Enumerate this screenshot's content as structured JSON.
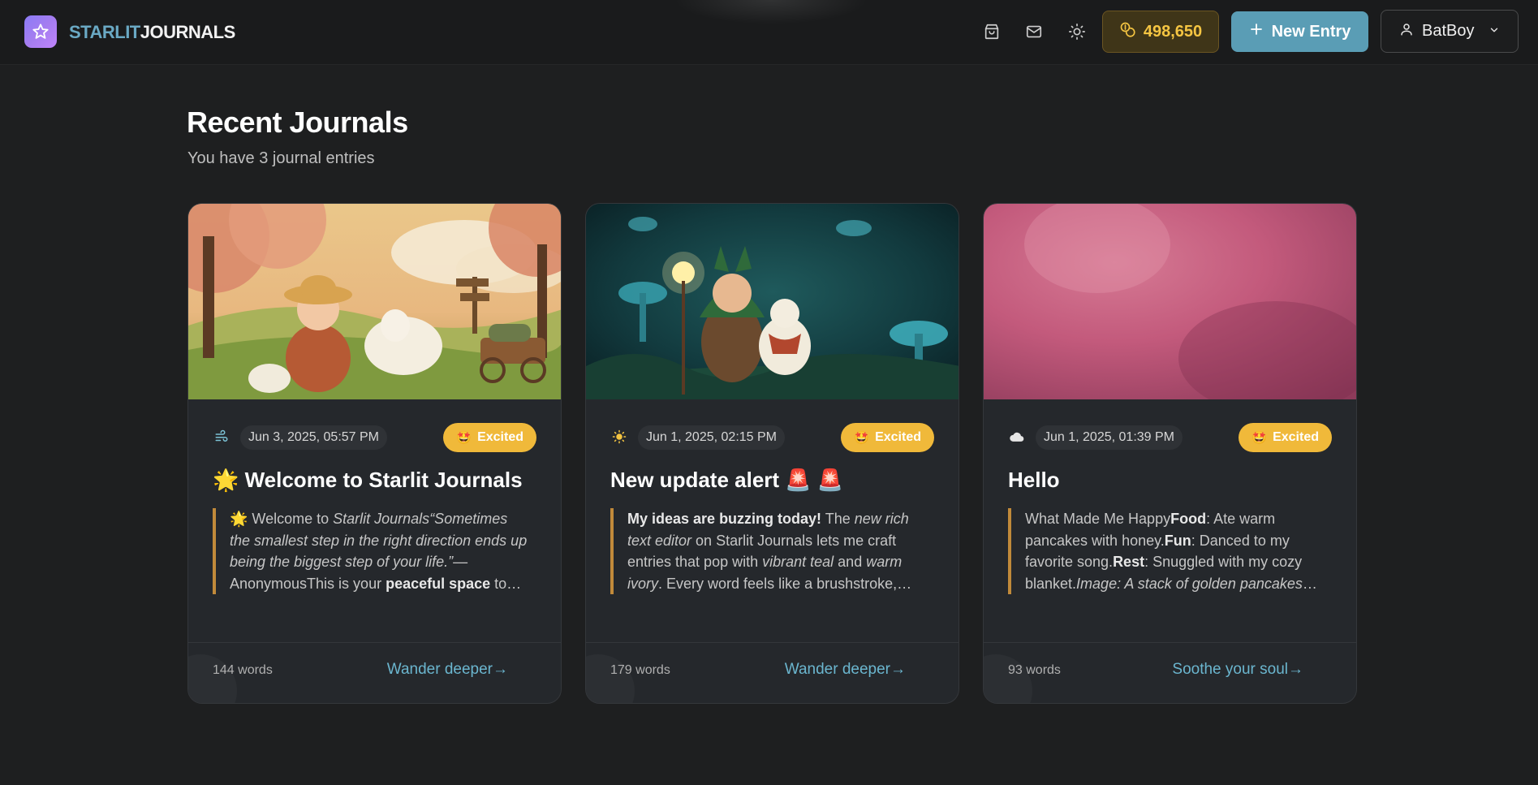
{
  "app": {
    "logo_part1": "STARLIT",
    "logo_part2": "JOURNALS",
    "coins": "498,650",
    "new_entry_label": "New Entry",
    "user_name": "BatBoy",
    "accent": "#5a9db5",
    "coin_color": "#f5c542",
    "mood_color": "#f0b93a"
  },
  "page": {
    "title": "Recent Journals",
    "subtitle": "You have 3 journal entries"
  },
  "cards": [
    {
      "weather_icon": "wind-icon",
      "weather_glyph": "🌬",
      "date": "Jun 3, 2025, 05:57 PM",
      "mood_emoji": "🤩",
      "mood": "Excited",
      "title": "🌟 Welcome to Starlit Journals",
      "excerpt_html": "🌟 Welcome to <i>Starlit Journals</i><i>“Sometimes the smallest step in the right direction ends up being the biggest step of your life.”</i>— AnonymousThis is your <b>peaceful space</b> to reflect and grow",
      "words": "144 words",
      "link": "Wander deeper→"
    },
    {
      "weather_icon": "sun-icon",
      "weather_glyph": "☀️",
      "date": "Jun 1, 2025, 02:15 PM",
      "mood_emoji": "🤩",
      "mood": "Excited",
      "title": "New update alert 🚨 🚨",
      "excerpt_html": "<b>My ideas are buzzing today!</b> The <i>new rich text editor</i> on Starlit Journals lets me craft entries that pop with <i>vibrant teal</i> and <i>warm ivory</i>. Every word feels like a brushstroke, painting my day",
      "words": "179 words",
      "link": "Wander deeper→"
    },
    {
      "weather_icon": "cloud-icon",
      "weather_glyph": "☁️",
      "date": "Jun 1, 2025, 01:39 PM",
      "mood_emoji": "🤩",
      "mood": "Excited",
      "title": "Hello",
      "excerpt_html": "What Made Me Happy<b>Food</b>: Ate warm pancakes with honey.<b>Fun</b>: Danced to my favorite song.<b>Rest</b>: Snuggled with my cozy blanket.<i>Image: A stack of golden pancakes with honey</i>",
      "words": "93 words",
      "link": "Soothe your soul→"
    }
  ]
}
